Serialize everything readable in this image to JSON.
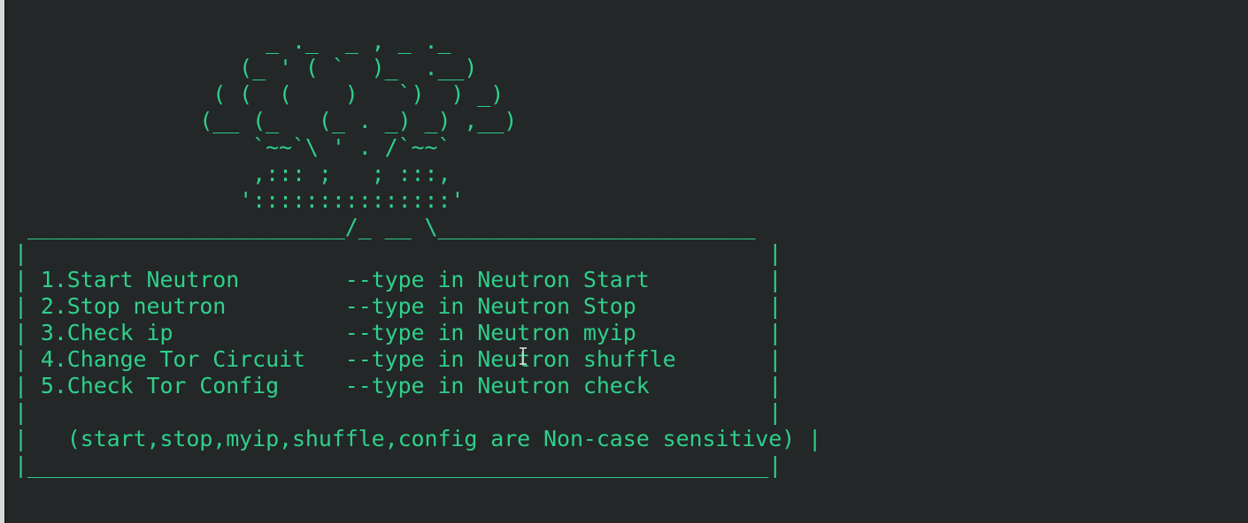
{
  "theme": {
    "background": "#232728",
    "text_color": "#2fd08a",
    "cursor_color": "#e6e6e6"
  },
  "terminal": {
    "lines": [
      "                   _ ._  _ , _ ._",
      "                 (_ ' ( `  )_  .__)",
      "               ( (  (    )   `)  ) _)",
      "              (__ (_   (_ . _) _) ,__)",
      "                  `~~`\\ ' . /`~~`",
      "                  ,::: ;   ; :::,",
      "                 ':::::::::::::::'",
      " ________________________/_ __ \\________________________",
      "|                                                        |",
      "| 1.Start Neutron        --type in Neutron Start         |",
      "| 2.Stop neutron         --type in Neutron Stop          |",
      "| 3.Check ip             --type in Neutron myip          |",
      "| 4.Change Tor Circuit   --type in Neutron shuffle       |",
      "| 5.Check Tor Config     --type in Neutron check         |",
      "|                                                        |",
      "|   (start,stop,myip,shuffle,config are Non-case sensitive) |",
      "|________________________________________________________|"
    ]
  },
  "cursor": {
    "icon": "text-ibeam-cursor-icon"
  }
}
